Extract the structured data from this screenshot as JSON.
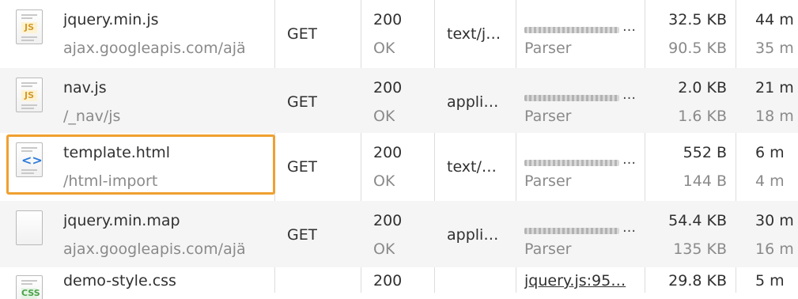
{
  "requests": [
    {
      "name": "jquery.min.js",
      "path": "ajax.googleapis.com/ajä",
      "icon": "js-file-icon",
      "badge": "JS",
      "method": "GET",
      "status_code": "200",
      "status_text": "OK",
      "type": "text/j…",
      "initiator_link": "…",
      "initiator_kind": "Parser",
      "size": "32.5 KB",
      "content": "90.5 KB",
      "time": "44 m",
      "latency": "35 m"
    },
    {
      "name": "nav.js",
      "path": "/_nav/js",
      "icon": "js-file-icon",
      "badge": "JS",
      "method": "GET",
      "status_code": "200",
      "status_text": "OK",
      "type": "appli…",
      "initiator_link": "…",
      "initiator_kind": "Parser",
      "size": "2.0 KB",
      "content": "1.6 KB",
      "time": "21 m",
      "latency": "18 m"
    },
    {
      "name": "template.html",
      "path": "/html-import",
      "icon": "html-file-icon",
      "badge": "<>",
      "method": "GET",
      "status_code": "200",
      "status_text": "OK",
      "type": "text/…",
      "initiator_link": "…",
      "initiator_kind": "Parser",
      "size": "552 B",
      "content": "144 B",
      "time": "6 m",
      "latency": "4 m",
      "highlighted": true
    },
    {
      "name": "jquery.min.map",
      "path": "ajax.googleapis.com/ajä",
      "icon": "generic-file-icon",
      "badge": "",
      "method": "GET",
      "status_code": "200",
      "status_text": "OK",
      "type": "appli…",
      "initiator_link": "…",
      "initiator_kind": "Parser",
      "size": "54.4 KB",
      "content": "135 KB",
      "time": "30 m",
      "latency": "16 m"
    },
    {
      "name": "demo-style.css",
      "icon": "css-file-icon",
      "badge": "CSS",
      "status_code": "200",
      "initiator_link": "jquery.js:95…",
      "size": "29.8 KB",
      "time": "5 m"
    }
  ],
  "colors": {
    "highlight_border": "#f0a030",
    "row_alt": "#f5f5f5",
    "muted_text": "#8a8a8a"
  }
}
